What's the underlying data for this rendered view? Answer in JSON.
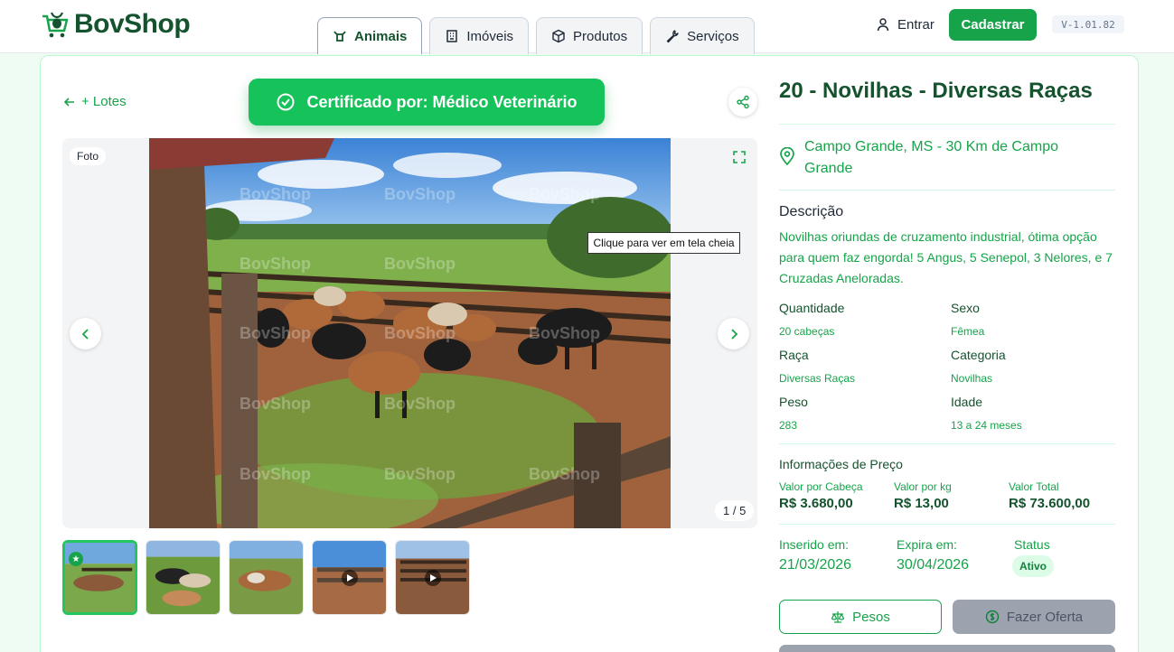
{
  "header": {
    "brand": "BovShop",
    "tabs": [
      {
        "label": "Animais",
        "icon": "cow-icon",
        "active": true
      },
      {
        "label": "Imóveis",
        "icon": "building-icon",
        "active": false
      },
      {
        "label": "Produtos",
        "icon": "box-icon",
        "active": false
      },
      {
        "label": "Serviços",
        "icon": "wrench-icon",
        "active": false
      }
    ],
    "login_label": "Entrar",
    "signup_label": "Cadastrar",
    "version": "V-1.01.82"
  },
  "listing": {
    "back_label": "+ Lotes",
    "certificate": "Certificado por: Médico Veterinário",
    "gallery": {
      "badge": "Foto",
      "counter": "1 / 5",
      "tooltip": "Clique para ver em tela cheia",
      "watermark": "BovShop",
      "thumbnails": [
        {
          "type": "photo",
          "selected": true,
          "starred": true
        },
        {
          "type": "photo",
          "selected": false
        },
        {
          "type": "photo",
          "selected": false
        },
        {
          "type": "video",
          "selected": false
        },
        {
          "type": "video",
          "selected": false
        }
      ]
    },
    "title": "20 - Novilhas - Diversas Raças",
    "location": "Campo Grande, MS - 30 Km de Campo Grande",
    "description_heading": "Descrição",
    "description": "Novilhas oriundas de cruzamento industrial, ótima opção para quem faz engorda! 5 Angus, 5 Senepol, 3 Nelores, e 7 Cruzadas Aneloradas.",
    "specs": [
      {
        "label": "Quantidade",
        "value": "20 cabeças"
      },
      {
        "label": "Sexo",
        "value": "Fêmea"
      },
      {
        "label": "Raça",
        "value": "Diversas Raças"
      },
      {
        "label": "Categoria",
        "value": "Novilhas"
      },
      {
        "label": "Peso",
        "value": "283"
      },
      {
        "label": "Idade",
        "value": "13 a 24 meses"
      }
    ],
    "price": {
      "heading": "Informações de Preço",
      "per_head_label": "Valor por Cabeça",
      "per_head": "R$ 3.680,00",
      "per_kg_label": "Valor por kg",
      "per_kg": "R$ 13,00",
      "total_label": "Valor Total",
      "total": "R$ 73.600,00"
    },
    "meta": {
      "inserted_label": "Inserido em:",
      "inserted": "21/03/2026",
      "expires_label": "Expira em:",
      "expires": "30/04/2026",
      "status_label": "Status",
      "status": "Ativo"
    },
    "actions": {
      "weights": "Pesos",
      "offer": "Fazer Oferta"
    }
  },
  "colors": {
    "brand_green": "#16a34a",
    "dark_green": "#14532d",
    "page_bg": "#effcf3"
  }
}
